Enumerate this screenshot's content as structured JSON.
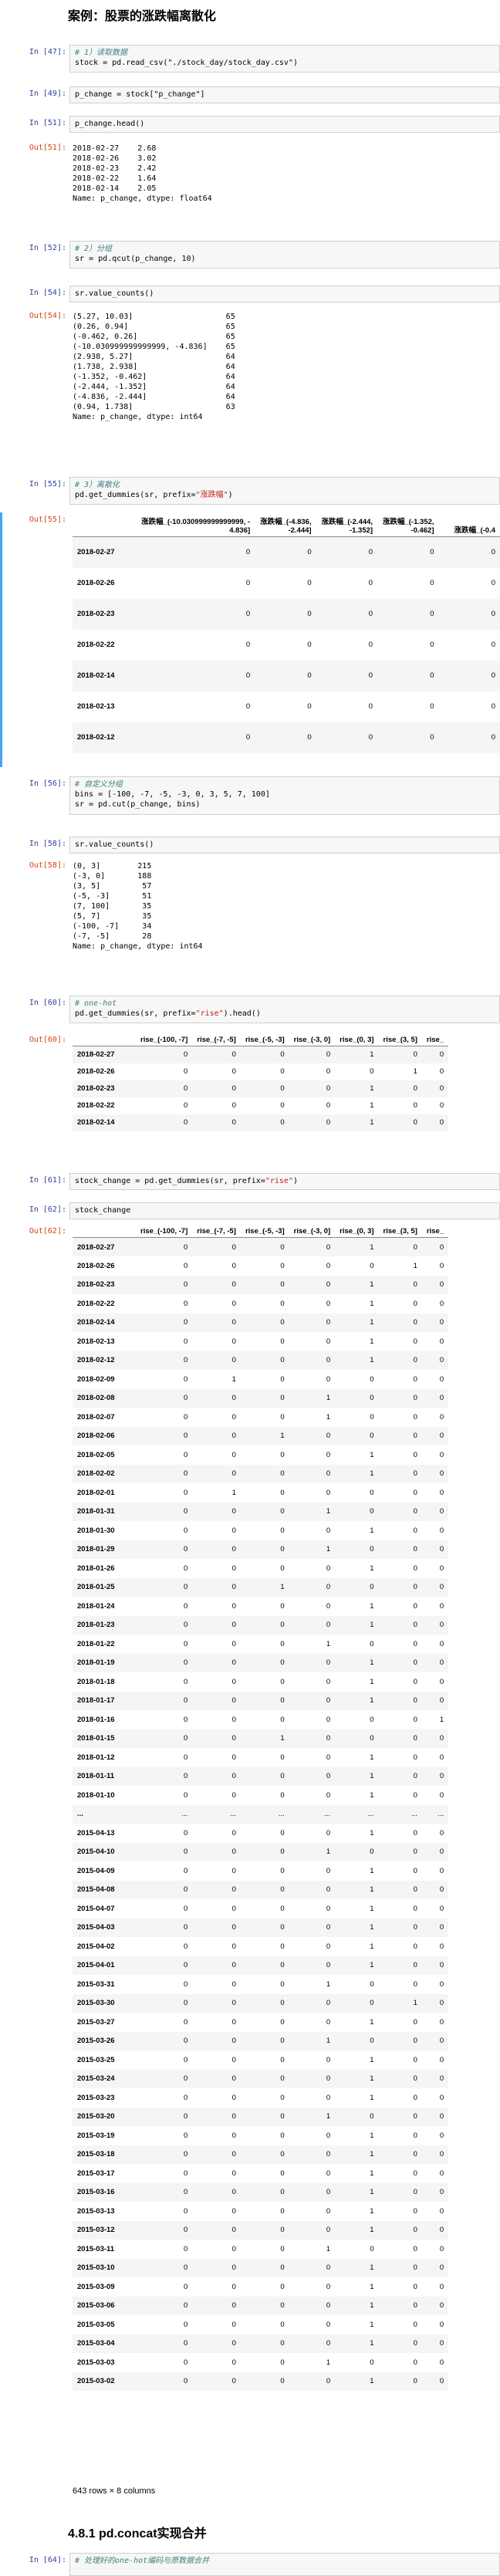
{
  "title": "案例：股票的涨跌幅离散化",
  "cells": {
    "c47": {
      "prompt": "In [47]:",
      "comment": "# 1）读取数据",
      "code": "stock = pd.read_csv(\"./stock_day/stock_day.csv\")"
    },
    "c49": {
      "prompt": "In [49]:",
      "code": "p_change = stock[\"p_change\"]"
    },
    "c51": {
      "prompt": "In [51]:",
      "code": "p_change.head()",
      "out_prompt": "Out[51]:",
      "output": "2018-02-27    2.68\n2018-02-26    3.02\n2018-02-23    2.42\n2018-02-22    1.64\n2018-02-14    2.05\nName: p_change, dtype: float64"
    },
    "c52": {
      "prompt": "In [52]:",
      "comment": "# 2）分组",
      "code": "sr = pd.qcut(p_change, 10)"
    },
    "c54": {
      "prompt": "In [54]:",
      "code": "sr.value_counts()",
      "out_prompt": "Out[54]:",
      "output": "(5.27, 10.03]                    65\n(0.26, 0.94]                     65\n(-0.462, 0.26]                   65\n(-10.030999999999999, -4.836]    65\n(2.938, 5.27]                    64\n(1.738, 2.938]                   64\n(-1.352, -0.462]                 64\n(-2.444, -1.352]                 64\n(-4.836, -2.444]                 64\n(0.94, 1.738]                    63\nName: p_change, dtype: int64"
    },
    "c55": {
      "prompt": "In [55]:",
      "comment": "# 3）离散化",
      "code": "pd.get_dummies(sr, prefix=\"涨跌幅\")",
      "out_prompt": "Out[55]:"
    },
    "c56": {
      "prompt": "In [56]:",
      "comment": "# 自定义分组",
      "code1": "bins = [-100, -7, -5, -3, 0, 3, 5, 7, 100]",
      "code2": "sr = pd.cut(p_change, bins)"
    },
    "c58": {
      "prompt": "In [58]:",
      "code": "sr.value_counts()",
      "out_prompt": "Out[58]:",
      "output": "(0, 3]        215\n(-3, 0]       188\n(3, 5]         57\n(-5, -3]       51\n(7, 100]       35\n(5, 7]         35\n(-100, -7]     34\n(-7, -5]       28\nName: p_change, dtype: int64"
    },
    "c60": {
      "prompt": "In [60]:",
      "comment": "# one-hot",
      "code": "pd.get_dummies(sr, prefix=\"rise\").head()",
      "out_prompt": "Out[60]:"
    },
    "c61": {
      "prompt": "In [61]:",
      "code": "stock_change = pd.get_dummies(sr, prefix=\"rise\")"
    },
    "c62": {
      "prompt": "In [62]:",
      "code": "stock_change",
      "out_prompt": "Out[62]:",
      "shape": "643 rows × 8 columns"
    }
  },
  "table55": {
    "columns": [
      "涨跌幅_(-10.030999999999999, -4.836]",
      "涨跌幅_(-4.836, -2.444]",
      "涨跌幅_(-2.444, -1.352]",
      "涨跌幅_(-1.352, -0.462]",
      "涨跌幅_(-0.4"
    ],
    "rows": [
      [
        "2018-02-27",
        0,
        0,
        0,
        0,
        0
      ],
      [
        "2018-02-26",
        0,
        0,
        0,
        0,
        0
      ],
      [
        "2018-02-23",
        0,
        0,
        0,
        0,
        0
      ],
      [
        "2018-02-22",
        0,
        0,
        0,
        0,
        0
      ],
      [
        "2018-02-14",
        0,
        0,
        0,
        0,
        0
      ],
      [
        "2018-02-13",
        0,
        0,
        0,
        0,
        0
      ],
      [
        "2018-02-12",
        0,
        0,
        0,
        0,
        0
      ]
    ]
  },
  "table60": {
    "columns": [
      "rise_(-100, -7]",
      "rise_(-7, -5]",
      "rise_(-5, -3]",
      "rise_(-3, 0]",
      "rise_(0, 3]",
      "rise_(3, 5]",
      "rise_"
    ],
    "rows": [
      [
        "2018-02-27",
        0,
        0,
        0,
        0,
        1,
        0,
        0
      ],
      [
        "2018-02-26",
        0,
        0,
        0,
        0,
        0,
        1,
        0
      ],
      [
        "2018-02-23",
        0,
        0,
        0,
        0,
        1,
        0,
        0
      ],
      [
        "2018-02-22",
        0,
        0,
        0,
        0,
        1,
        0,
        0
      ],
      [
        "2018-02-14",
        0,
        0,
        0,
        0,
        1,
        0,
        0
      ]
    ]
  },
  "table62": {
    "columns": [
      "rise_(-100, -7]",
      "rise_(-7, -5]",
      "rise_(-5, -3]",
      "rise_(-3, 0]",
      "rise_(0, 3]",
      "rise_(3, 5]",
      "rise_"
    ],
    "rows": [
      [
        "2018-02-27",
        0,
        0,
        0,
        0,
        1,
        0,
        0
      ],
      [
        "2018-02-26",
        0,
        0,
        0,
        0,
        0,
        1,
        0
      ],
      [
        "2018-02-23",
        0,
        0,
        0,
        0,
        1,
        0,
        0
      ],
      [
        "2018-02-22",
        0,
        0,
        0,
        0,
        1,
        0,
        0
      ],
      [
        "2018-02-14",
        0,
        0,
        0,
        0,
        1,
        0,
        0
      ],
      [
        "2018-02-13",
        0,
        0,
        0,
        0,
        1,
        0,
        0
      ],
      [
        "2018-02-12",
        0,
        0,
        0,
        0,
        1,
        0,
        0
      ],
      [
        "2018-02-09",
        0,
        1,
        0,
        0,
        0,
        0,
        0
      ],
      [
        "2018-02-08",
        0,
        0,
        0,
        1,
        0,
        0,
        0
      ],
      [
        "2018-02-07",
        0,
        0,
        0,
        1,
        0,
        0,
        0
      ],
      [
        "2018-02-06",
        0,
        0,
        1,
        0,
        0,
        0,
        0
      ],
      [
        "2018-02-05",
        0,
        0,
        0,
        0,
        1,
        0,
        0
      ],
      [
        "2018-02-02",
        0,
        0,
        0,
        0,
        1,
        0,
        0
      ],
      [
        "2018-02-01",
        0,
        1,
        0,
        0,
        0,
        0,
        0
      ],
      [
        "2018-01-31",
        0,
        0,
        0,
        1,
        0,
        0,
        0
      ],
      [
        "2018-01-30",
        0,
        0,
        0,
        0,
        1,
        0,
        0
      ],
      [
        "2018-01-29",
        0,
        0,
        0,
        1,
        0,
        0,
        0
      ],
      [
        "2018-01-26",
        0,
        0,
        0,
        0,
        1,
        0,
        0
      ],
      [
        "2018-01-25",
        0,
        0,
        1,
        0,
        0,
        0,
        0
      ],
      [
        "2018-01-24",
        0,
        0,
        0,
        0,
        1,
        0,
        0
      ],
      [
        "2018-01-23",
        0,
        0,
        0,
        0,
        1,
        0,
        0
      ],
      [
        "2018-01-22",
        0,
        0,
        0,
        1,
        0,
        0,
        0
      ],
      [
        "2018-01-19",
        0,
        0,
        0,
        0,
        1,
        0,
        0
      ],
      [
        "2018-01-18",
        0,
        0,
        0,
        0,
        1,
        0,
        0
      ],
      [
        "2018-01-17",
        0,
        0,
        0,
        0,
        1,
        0,
        0
      ],
      [
        "2018-01-16",
        0,
        0,
        0,
        0,
        0,
        0,
        1
      ],
      [
        "2018-01-15",
        0,
        0,
        1,
        0,
        0,
        0,
        0
      ],
      [
        "2018-01-12",
        0,
        0,
        0,
        0,
        1,
        0,
        0
      ],
      [
        "2018-01-11",
        0,
        0,
        0,
        0,
        1,
        0,
        0
      ],
      [
        "2018-01-10",
        0,
        0,
        0,
        0,
        1,
        0,
        0
      ],
      [
        "...",
        "...",
        "...",
        "...",
        "...",
        "...",
        "...",
        "..."
      ],
      [
        "2015-04-13",
        0,
        0,
        0,
        0,
        1,
        0,
        0
      ],
      [
        "2015-04-10",
        0,
        0,
        0,
        1,
        0,
        0,
        0
      ],
      [
        "2015-04-09",
        0,
        0,
        0,
        0,
        1,
        0,
        0
      ],
      [
        "2015-04-08",
        0,
        0,
        0,
        0,
        1,
        0,
        0
      ],
      [
        "2015-04-07",
        0,
        0,
        0,
        0,
        1,
        0,
        0
      ],
      [
        "2015-04-03",
        0,
        0,
        0,
        0,
        1,
        0,
        0
      ],
      [
        "2015-04-02",
        0,
        0,
        0,
        0,
        1,
        0,
        0
      ],
      [
        "2015-04-01",
        0,
        0,
        0,
        0,
        1,
        0,
        0
      ],
      [
        "2015-03-31",
        0,
        0,
        0,
        1,
        0,
        0,
        0
      ],
      [
        "2015-03-30",
        0,
        0,
        0,
        0,
        0,
        1,
        0
      ],
      [
        "2015-03-27",
        0,
        0,
        0,
        0,
        1,
        0,
        0
      ],
      [
        "2015-03-26",
        0,
        0,
        0,
        1,
        0,
        0,
        0
      ],
      [
        "2015-03-25",
        0,
        0,
        0,
        0,
        1,
        0,
        0
      ],
      [
        "2015-03-24",
        0,
        0,
        0,
        0,
        1,
        0,
        0
      ],
      [
        "2015-03-23",
        0,
        0,
        0,
        0,
        1,
        0,
        0
      ],
      [
        "2015-03-20",
        0,
        0,
        0,
        1,
        0,
        0,
        0
      ],
      [
        "2015-03-19",
        0,
        0,
        0,
        0,
        1,
        0,
        0
      ],
      [
        "2015-03-18",
        0,
        0,
        0,
        0,
        1,
        0,
        0
      ],
      [
        "2015-03-17",
        0,
        0,
        0,
        0,
        1,
        0,
        0
      ],
      [
        "2015-03-16",
        0,
        0,
        0,
        0,
        1,
        0,
        0
      ],
      [
        "2015-03-13",
        0,
        0,
        0,
        0,
        1,
        0,
        0
      ],
      [
        "2015-03-12",
        0,
        0,
        0,
        0,
        1,
        0,
        0
      ],
      [
        "2015-03-11",
        0,
        0,
        0,
        1,
        0,
        0,
        0
      ],
      [
        "2015-03-10",
        0,
        0,
        0,
        0,
        1,
        0,
        0
      ],
      [
        "2015-03-09",
        0,
        0,
        0,
        0,
        1,
        0,
        0
      ],
      [
        "2015-03-06",
        0,
        0,
        0,
        0,
        1,
        0,
        0
      ],
      [
        "2015-03-05",
        0,
        0,
        0,
        0,
        1,
        0,
        0
      ],
      [
        "2015-03-04",
        0,
        0,
        0,
        0,
        1,
        0,
        0
      ],
      [
        "2015-03-03",
        0,
        0,
        0,
        1,
        0,
        0,
        0
      ],
      [
        "2015-03-02",
        0,
        0,
        0,
        0,
        1,
        0,
        0
      ]
    ]
  },
  "next_heading": "4.8.1 pd.concat实现合并",
  "next_prompt": "In [64]:",
  "next_comment": "# 处理好的one-hot编码与原数据合并"
}
